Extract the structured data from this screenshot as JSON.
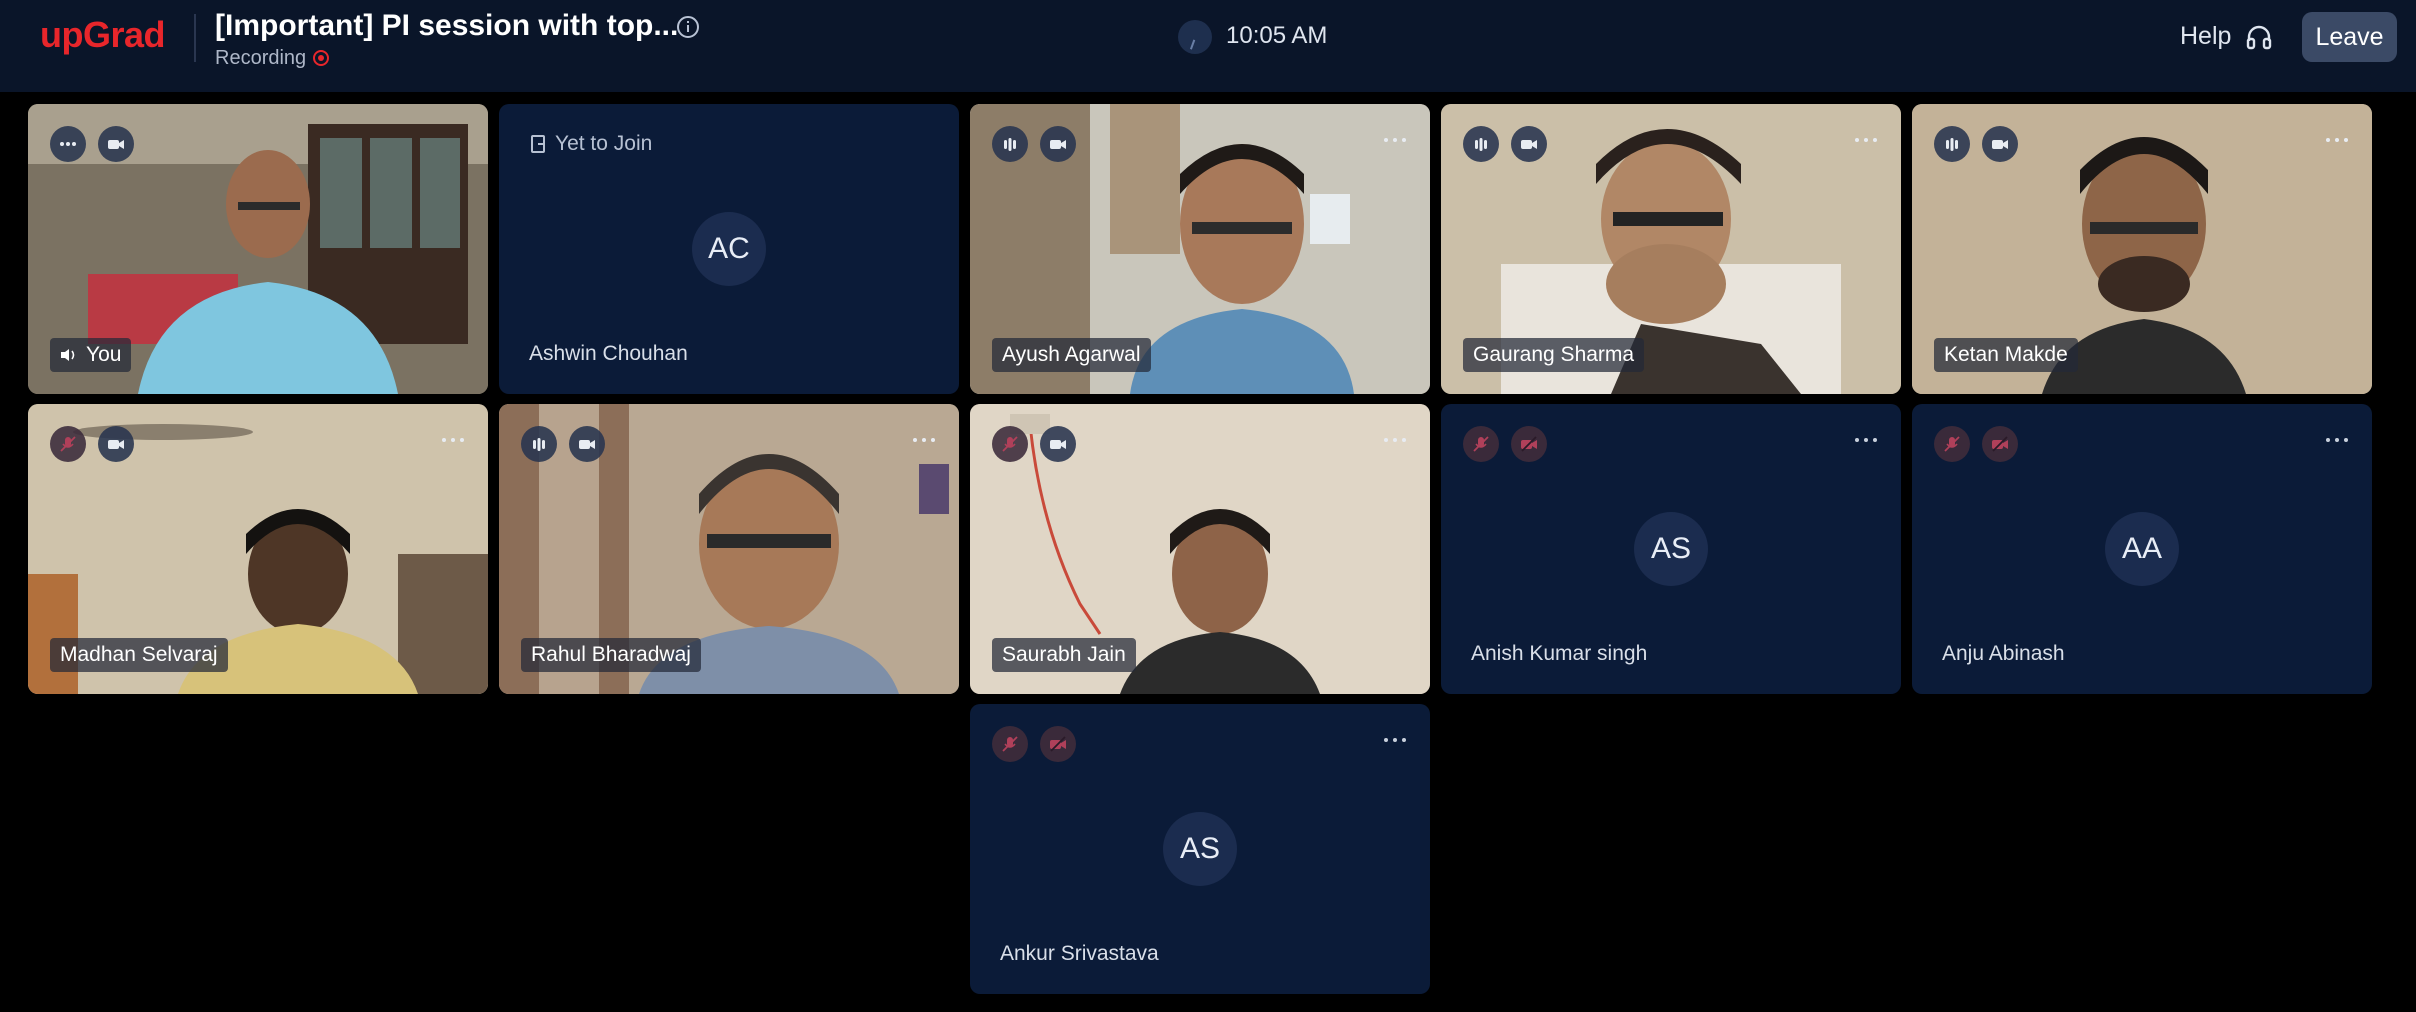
{
  "header": {
    "logo": "upGrad",
    "session_title": "[Important] PI session with top...",
    "recording_label": "Recording",
    "time": "10:05 AM",
    "help_label": "Help",
    "leave_label": "Leave"
  },
  "icons": {
    "info": "info-icon",
    "recording": "record-dot-icon",
    "clock": "clock-icon",
    "help": "headset-icon",
    "more": "more-options-icon",
    "mic": "mic-icon",
    "mic_off": "mic-off-icon",
    "camera": "camera-icon",
    "camera_off": "camera-off-icon",
    "speaking": "audio-level-icon",
    "speaker": "speaker-icon",
    "join": "door-icon"
  },
  "colors": {
    "brand": "#e8262b",
    "header_bg": "#0a1529",
    "tile_bg": "#0b1b38",
    "page_bg": "#000000"
  },
  "participants": [
    {
      "name": "You",
      "initials": "",
      "status": ""
    },
    {
      "name": "Ashwin Chouhan",
      "initials": "AC",
      "status": "Yet to Join"
    },
    {
      "name": "Ayush Agarwal",
      "initials": "",
      "status": ""
    },
    {
      "name": "Gaurang Sharma",
      "initials": "",
      "status": ""
    },
    {
      "name": "Ketan Makde",
      "initials": "",
      "status": ""
    },
    {
      "name": "Madhan Selvaraj",
      "initials": "",
      "status": ""
    },
    {
      "name": "Rahul Bharadwaj",
      "initials": "",
      "status": ""
    },
    {
      "name": "Saurabh Jain",
      "initials": "",
      "status": ""
    },
    {
      "name": "Anish Kumar singh",
      "initials": "AS",
      "status": ""
    },
    {
      "name": "Anju Abinash",
      "initials": "AA",
      "status": ""
    },
    {
      "name": "Ankur Srivastava",
      "initials": "AS",
      "status": ""
    }
  ]
}
